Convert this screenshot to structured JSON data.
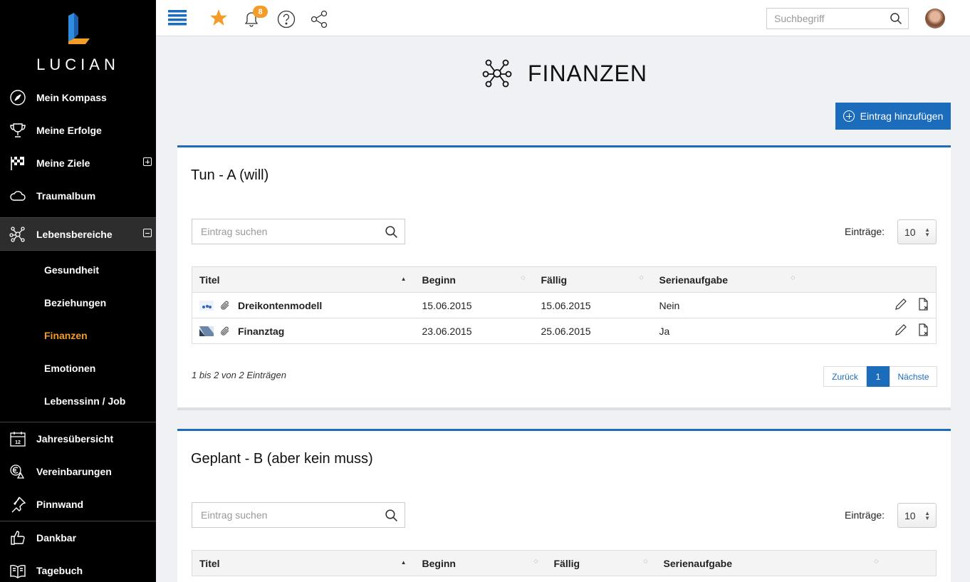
{
  "brand": {
    "name": "LUCIAN"
  },
  "sidebar": {
    "items": [
      {
        "label": "Mein Kompass",
        "icon": "compass-icon"
      },
      {
        "label": "Meine Erfolge",
        "icon": "trophy-icon"
      },
      {
        "label": "Meine Ziele",
        "icon": "checkered-flag-icon"
      },
      {
        "label": "Traumalbum",
        "icon": "cloud-icon"
      },
      {
        "label": "Lebensbereiche",
        "icon": "network-icon"
      }
    ],
    "subitems": [
      {
        "label": "Gesundheit"
      },
      {
        "label": "Beziehungen"
      },
      {
        "label": "Finanzen"
      },
      {
        "label": "Emotionen"
      },
      {
        "label": "Lebenssinn / Job"
      }
    ],
    "items2": [
      {
        "label": "Jahresübersicht",
        "icon": "calendar-icon",
        "day": "12"
      },
      {
        "label": "Vereinbarungen",
        "icon": "euro-warning-icon"
      },
      {
        "label": "Pinnwand",
        "icon": "pin-icon"
      },
      {
        "label": "Dankbar",
        "icon": "thumbs-up-icon"
      },
      {
        "label": "Tagebuch",
        "icon": "book-icon"
      }
    ]
  },
  "topbar": {
    "notification_count": "8",
    "search_placeholder": "Suchbegriff"
  },
  "page": {
    "title": "FINANZEN",
    "add_button": "Eintrag hinzufügen"
  },
  "panels": [
    {
      "title": "Tun - A (will)",
      "search_placeholder": "Eintrag suchen",
      "entries_label": "Einträge:",
      "entries_value": "10",
      "columns": [
        "Titel",
        "Beginn",
        "Fällig",
        "Serienaufgabe"
      ],
      "rows": [
        {
          "title": "Dreikontenmodell",
          "beginn": "15.06.2015",
          "faellig": "15.06.2015",
          "serie": "Nein"
        },
        {
          "title": "Finanztag",
          "beginn": "23.06.2015",
          "faellig": "25.06.2015",
          "serie": "Ja"
        }
      ],
      "info": "1 bis 2 von 2 Einträgen",
      "pager": {
        "prev": "Zurück",
        "current": "1",
        "next": "Nächste"
      }
    },
    {
      "title": "Geplant - B (aber kein muss)",
      "search_placeholder": "Eintrag suchen",
      "entries_label": "Einträge:",
      "entries_value": "10",
      "columns": [
        "Titel",
        "Beginn",
        "Fällig",
        "Serienaufgabe"
      ]
    }
  ],
  "colors": {
    "accent": "#1b6dbc",
    "active_nav": "#f39c28",
    "sidebar_bg": "#000000"
  }
}
